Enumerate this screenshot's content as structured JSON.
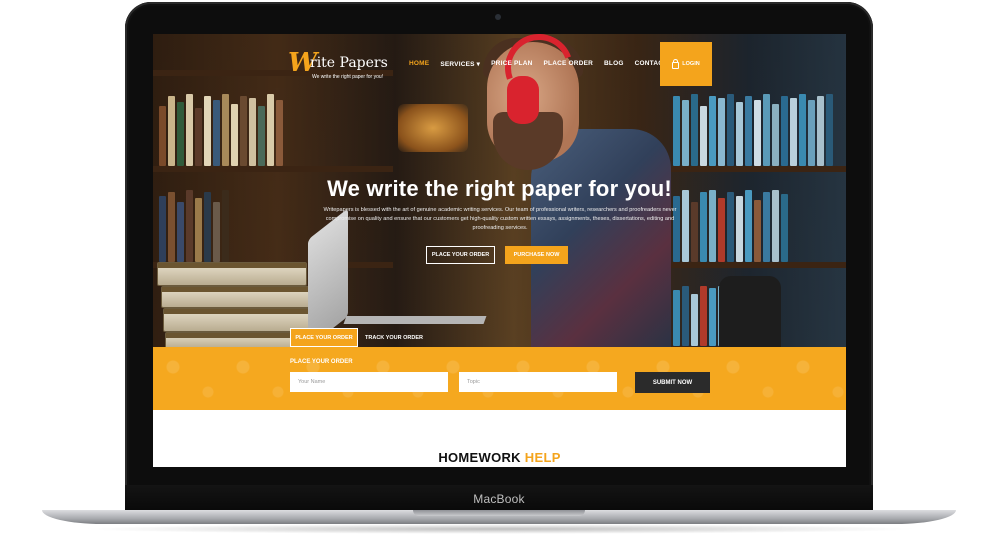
{
  "device": {
    "label": "MacBook"
  },
  "site": {
    "logo_mark": "W",
    "logo_name": "rite Papers",
    "tagline": "We write the right paper for you!",
    "nav": [
      "HOME",
      "SERVICES ▾",
      "PRICE PLAN",
      "PLACE ORDER",
      "BLOG",
      "CONTACT"
    ],
    "login_label": "LOGIN",
    "accent_color": "#f4a41c"
  },
  "hero": {
    "title": "We write the right paper for you!",
    "description": "Writepapers is blessed with the art of genuine academic writing services. Our team of professional writers, researchers and proofreaders never compromise on quality and ensure that our customers get high-quality custom written essays, assignments, theses, dissertations, editing and proofreading services.",
    "btn_place_order": "PLACE YOUR ORDER",
    "btn_purchase": "PURCHASE NOW",
    "tab_place_order": "PLACE YOUR ORDER",
    "tab_track_order": "TRACK YOUR ORDER"
  },
  "order_form": {
    "label": "PLACE YOUR ORDER",
    "name_placeholder": "Your Name",
    "topic_placeholder": "Topic",
    "submit_label": "SUBMIT NOW"
  },
  "section": {
    "title_main": "HOMEWORK",
    "title_accent": "HELP"
  }
}
